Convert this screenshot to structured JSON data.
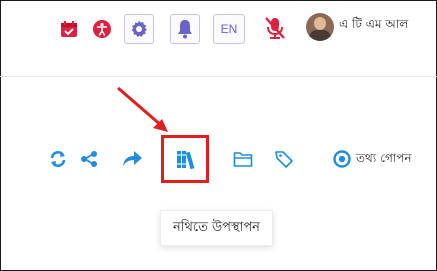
{
  "header": {
    "language_label": "EN",
    "user_name": "এ টি এম আল"
  },
  "toolbar": {
    "info_label": "তথ্য গোপন"
  },
  "tooltip": {
    "text": "নথিতে উপস্থাপন"
  },
  "colors": {
    "accent": "#6b62c9",
    "danger": "#e02040",
    "toolbar_icon": "#1f8de0",
    "highlight": "#e02020"
  },
  "icons": [
    "calendar-check-icon",
    "accessibility-icon",
    "gear-icon",
    "bell-icon",
    "mic-off-icon",
    "refresh-icon",
    "share-icon",
    "forward-icon",
    "books-icon",
    "folder-icon",
    "tag-icon",
    "radio-icon",
    "arrow-pointer"
  ]
}
